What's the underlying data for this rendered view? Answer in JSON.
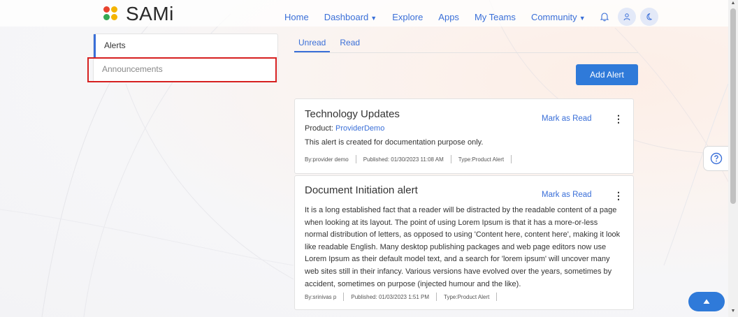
{
  "header": {
    "logo_text": "SAMi",
    "nav": [
      {
        "label": "Home"
      },
      {
        "label": "Dashboard",
        "dropdown": true
      },
      {
        "label": "Explore"
      },
      {
        "label": "Apps"
      },
      {
        "label": "My Teams"
      },
      {
        "label": "Community",
        "dropdown": true
      }
    ],
    "icons": [
      "bell-icon",
      "user-icon",
      "moon-icon"
    ]
  },
  "sidebar": {
    "items": [
      {
        "label": "Alerts",
        "active": true
      },
      {
        "label": "Announcements",
        "active": false
      }
    ]
  },
  "tabs": [
    {
      "label": "Unread",
      "active": true
    },
    {
      "label": "Read",
      "active": false
    }
  ],
  "add_alert_label": "Add Alert",
  "alerts": [
    {
      "title": "Technology Updates",
      "mark_label": "Mark as Read",
      "product_label": "Product:",
      "product_name": "ProviderDemo",
      "body": "This alert is created for documentation purpose only.",
      "meta": {
        "by": "By:provider demo",
        "published": "Published: 01/30/2023 11:08 AM",
        "type": "Type:Product Alert"
      }
    },
    {
      "title": "Document Initiation alert",
      "mark_label": "Mark as Read",
      "body_lines": [
        "It is a long established fact that a reader will be distracted by the readable content of a page",
        "when looking at its layout. The point of using Lorem Ipsum is that it has a more-or-less",
        "normal distribution of letters, as opposed to using 'Content here, content here', making it look",
        "like readable English. Many desktop publishing packages and web page editors now use",
        "Lorem Ipsum as their default model text, and a search for 'lorem ipsum' will uncover many",
        "web sites still in their infancy. Various versions have evolved over the years, sometimes by",
        "accident, sometimes on purpose (injected humour and the like)."
      ],
      "meta": {
        "by": "By:srinivas p",
        "published": "Published: 01/03/2023 1:51 PM",
        "type": "Type:Product Alert"
      }
    }
  ],
  "colors": {
    "accent": "#3a6fd8",
    "button": "#2f7ad9",
    "highlight": "#d62020",
    "logo": [
      "#e8432e",
      "#f4b400",
      "#34a853",
      "#4285f4"
    ]
  }
}
